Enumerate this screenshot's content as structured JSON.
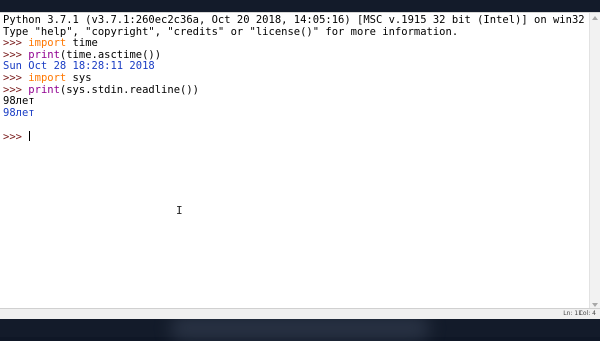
{
  "shell": {
    "lines": [
      {
        "kind": "banner",
        "text": "Python 3.7.1 (v3.7.1:260ec2c36a, Oct 20 2018, 14:05:16) [MSC v.1915 32 bit (Intel)] on win32"
      },
      {
        "kind": "banner",
        "text": "Type \"help\", \"copyright\", \"credits\" or \"license()\" for more information."
      },
      {
        "kind": "cmd",
        "prompt": ">>> ",
        "keyword": "import",
        "rest": " time"
      },
      {
        "kind": "call",
        "prompt": ">>> ",
        "builtin": "print",
        "rest": "(time.asctime())"
      },
      {
        "kind": "output",
        "text": "Sun Oct 28 18:28:11 2018"
      },
      {
        "kind": "cmd",
        "prompt": ">>> ",
        "keyword": "import",
        "rest": " sys"
      },
      {
        "kind": "call",
        "prompt": ">>> ",
        "builtin": "print",
        "rest": "(sys.stdin.readline())"
      },
      {
        "kind": "stdin",
        "text": "98лет"
      },
      {
        "kind": "output",
        "text": "98лет"
      },
      {
        "kind": "blank",
        "text": ""
      },
      {
        "kind": "current",
        "prompt": ">>> "
      }
    ]
  },
  "statusbar": {
    "position": "Ln: 11",
    "column": "Col: 4"
  },
  "colors": {
    "prompt": "#7a1d1d",
    "keyword": "#ff7700",
    "builtin": "#900090",
    "output": "#1a3dc4"
  }
}
